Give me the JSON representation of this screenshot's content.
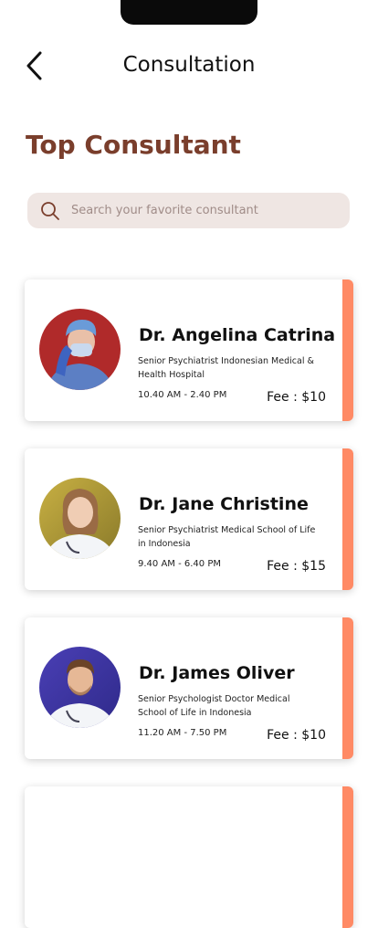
{
  "header": {
    "title": "Consultation"
  },
  "section": {
    "title": "Top Consultant"
  },
  "search": {
    "placeholder": "Search your favorite consultant"
  },
  "colors": {
    "accent": "#ff8a65",
    "title": "#7a3e2c",
    "search_bg": "#efe6e3"
  },
  "doctors": [
    {
      "name": "Dr. Angelina Catrina",
      "description": "Senior Psychiatrist Indonesian Medical & Health Hospital",
      "hours": "10.40 AM - 2.40 PM",
      "fee": "Fee : $10"
    },
    {
      "name": "Dr. Jane Christine",
      "description": "Senior Psychiatrist Medical School of Life in Indonesia",
      "hours": "9.40 AM - 6.40 PM",
      "fee": "Fee : $15"
    },
    {
      "name": "Dr. James Oliver",
      "description": "Senior Psychologist Doctor Medical School of Life in Indonesia",
      "hours": "11.20 AM - 7.50 PM",
      "fee": "Fee : $10"
    }
  ]
}
